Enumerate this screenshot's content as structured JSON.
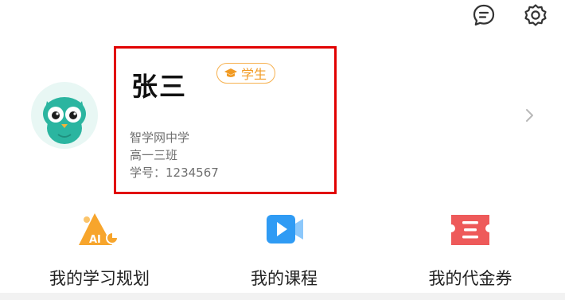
{
  "header": {
    "message_icon": "message-bubble-icon",
    "settings_icon": "gear-icon"
  },
  "profile": {
    "avatar": "owl-avatar",
    "name": "张三",
    "role_badge": "学生",
    "school": "智学网中学",
    "class": "高一三班",
    "student_id": "学号：1234567"
  },
  "shortcuts": [
    {
      "label": "我的学习规划",
      "icon": "ai-learning-plan-icon"
    },
    {
      "label": "我的课程",
      "icon": "video-course-icon"
    },
    {
      "label": "我的代金券",
      "icon": "voucher-ticket-icon"
    }
  ],
  "colors": {
    "highlight_border": "#e10000",
    "badge_orange": "#f19a22",
    "owl_teal": "#2bb5a0",
    "course_blue": "#2f9bf4",
    "voucher_red": "#ee5a5a",
    "ai_orange": "#f7a52c"
  }
}
